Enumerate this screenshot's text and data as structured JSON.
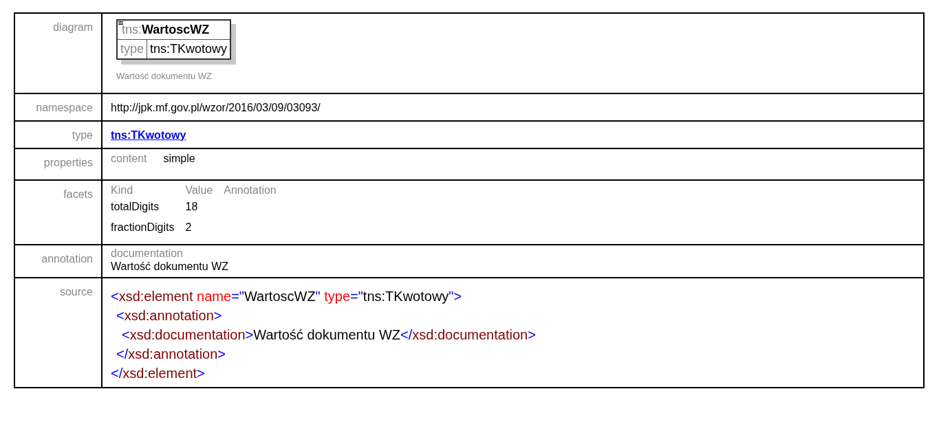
{
  "rows": [
    {
      "kind": "diagram",
      "label": "diagram",
      "element": {
        "prefix": "tns:",
        "name": "WartoscWZ",
        "type_label": "type",
        "type_value": "tns:TKwotowy",
        "caption": "Wartość dokumentu WZ"
      }
    },
    {
      "kind": "text",
      "label": "namespace",
      "value": "http://jpk.mf.gov.pl/wzor/2016/03/09/03093/"
    },
    {
      "kind": "link",
      "label": "type",
      "value": "tns:TKwotowy"
    },
    {
      "kind": "properties",
      "label": "properties",
      "items": [
        {
          "name": "content",
          "value": "simple"
        }
      ]
    },
    {
      "kind": "facets",
      "label": "facets",
      "columns": [
        "Kind",
        "Value",
        "Annotation"
      ],
      "rows": [
        [
          "totalDigits",
          "18"
        ],
        [
          "fractionDigits",
          "2"
        ]
      ]
    },
    {
      "kind": "annotation",
      "label": "annotation",
      "heading": "documentation",
      "value": "Wartość dokumentu WZ"
    },
    {
      "kind": "source",
      "label": "source",
      "code": {
        "open": [
          {
            "kind": "punct",
            "text": "<"
          },
          {
            "kind": "tag",
            "text": "xsd:element"
          },
          {
            "kind": "attr",
            "text": " name"
          },
          {
            "kind": "punct",
            "text": "=\""
          },
          {
            "kind": "value",
            "text": "WartoscWZ"
          },
          {
            "kind": "punct",
            "text": "\""
          },
          {
            "kind": "attr",
            "text": " type"
          },
          {
            "kind": "punct",
            "text": "=\""
          },
          {
            "kind": "value",
            "text": "tns:TKwotowy"
          },
          {
            "kind": "punct",
            "text": "\">"
          }
        ],
        "children": [
          {
            "open": [
              {
                "kind": "punct",
                "text": "<"
              },
              {
                "kind": "tag",
                "text": "xsd:annotation"
              },
              {
                "kind": "punct",
                "text": ">"
              }
            ],
            "children": [
              {
                "open": [
                  {
                    "kind": "punct",
                    "text": "<"
                  },
                  {
                    "kind": "tag",
                    "text": "xsd:documentation"
                  },
                  {
                    "kind": "punct",
                    "text": ">"
                  },
                  {
                    "kind": "value",
                    "text": "Wartość dokumentu WZ"
                  },
                  {
                    "kind": "punct",
                    "text": "</"
                  },
                  {
                    "kind": "tag",
                    "text": "xsd:documentation"
                  },
                  {
                    "kind": "punct",
                    "text": ">"
                  }
                ]
              }
            ],
            "close": [
              {
                "kind": "punct",
                "text": "</"
              },
              {
                "kind": "tag",
                "text": "xsd:annotation"
              },
              {
                "kind": "punct",
                "text": ">"
              }
            ]
          }
        ],
        "close": [
          {
            "kind": "punct",
            "text": "</"
          },
          {
            "kind": "tag",
            "text": "xsd:element"
          },
          {
            "kind": "punct",
            "text": ">"
          }
        ]
      }
    }
  ]
}
